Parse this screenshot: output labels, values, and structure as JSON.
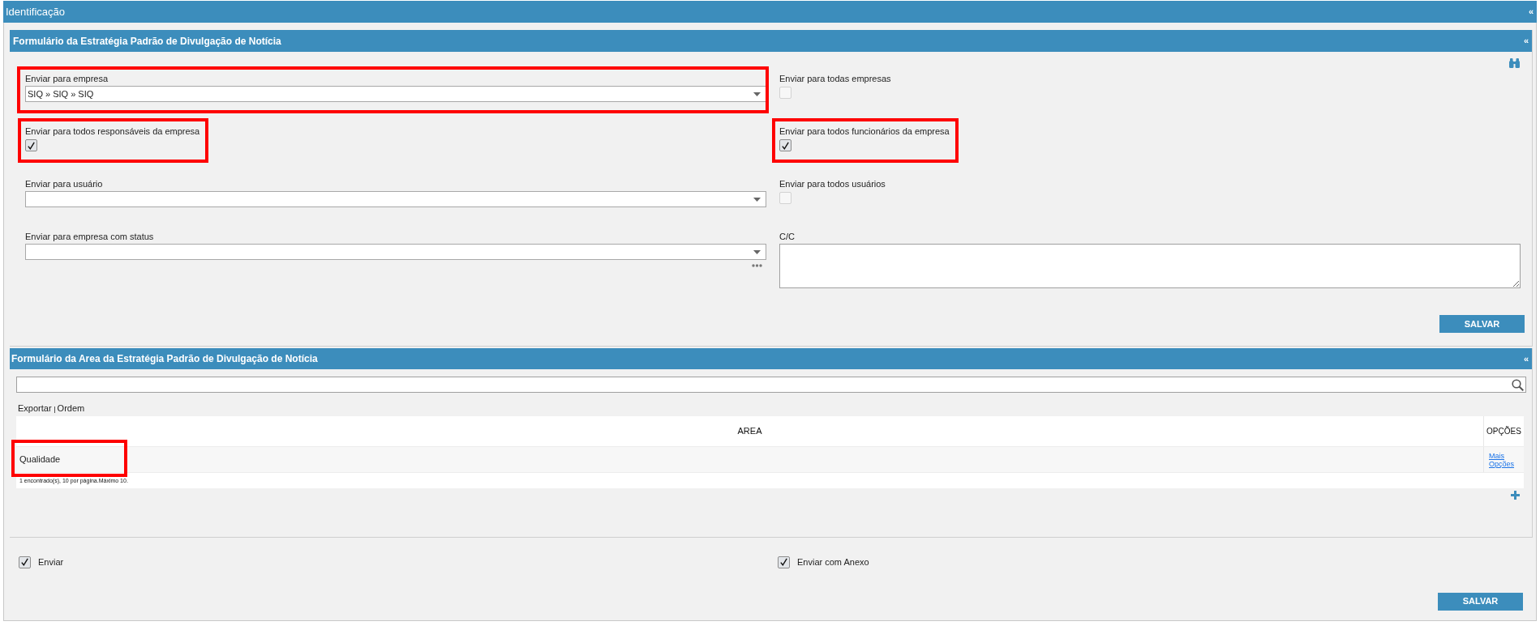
{
  "window": {
    "title": "Identificação",
    "collapse_glyph": "«"
  },
  "form_panel": {
    "title": "Formulário da Estratégia Padrão de Divulgação de Notícia",
    "collapse_glyph": "«",
    "fields": [
      {
        "kind": "select",
        "label": "Enviar para empresa",
        "value": "SIQ » SIQ » SIQ",
        "highlighted": true
      },
      {
        "kind": "checkbox",
        "label": "Enviar para todas empresas",
        "checked": false,
        "highlighted": false
      },
      {
        "kind": "checkbox",
        "label": "Enviar para todos responsáveis da empresa",
        "checked": true,
        "highlighted": true
      },
      {
        "kind": "checkbox",
        "label": "Enviar para todos funcionários da empresa",
        "checked": true,
        "highlighted": true
      },
      {
        "kind": "select",
        "label": "Enviar para usuário",
        "highlighted": false
      },
      {
        "kind": "checkbox",
        "label": "Enviar para todos usuários",
        "checked": false,
        "highlighted": false
      },
      {
        "kind": "select",
        "label": "Enviar para empresa com status",
        "more_options": true,
        "highlighted": false
      },
      {
        "kind": "textarea",
        "label": "C/C",
        "highlighted": false
      }
    ],
    "save_button": "SALVAR"
  },
  "area_panel": {
    "title": "Formulário da Area da Estratégia Padrão de Divulgação de Notícia",
    "collapse_glyph": "«",
    "toolbar": [
      {
        "label": "Exportar"
      },
      {
        "label": "Ordem"
      }
    ],
    "table": {
      "columns": [
        "AREA",
        "OPÇÕES"
      ],
      "rows": [
        {
          "cells": [
            "Qualidade"
          ],
          "link": "Mais Opções",
          "highlighted": true
        }
      ]
    },
    "pager": "1 encontrado(s), 10 por página.Máximo 10."
  },
  "options": [
    {
      "label": "Enviar",
      "checked": true
    },
    {
      "label": "Enviar com Anexo",
      "checked": true
    }
  ],
  "save_button": "SALVAR"
}
